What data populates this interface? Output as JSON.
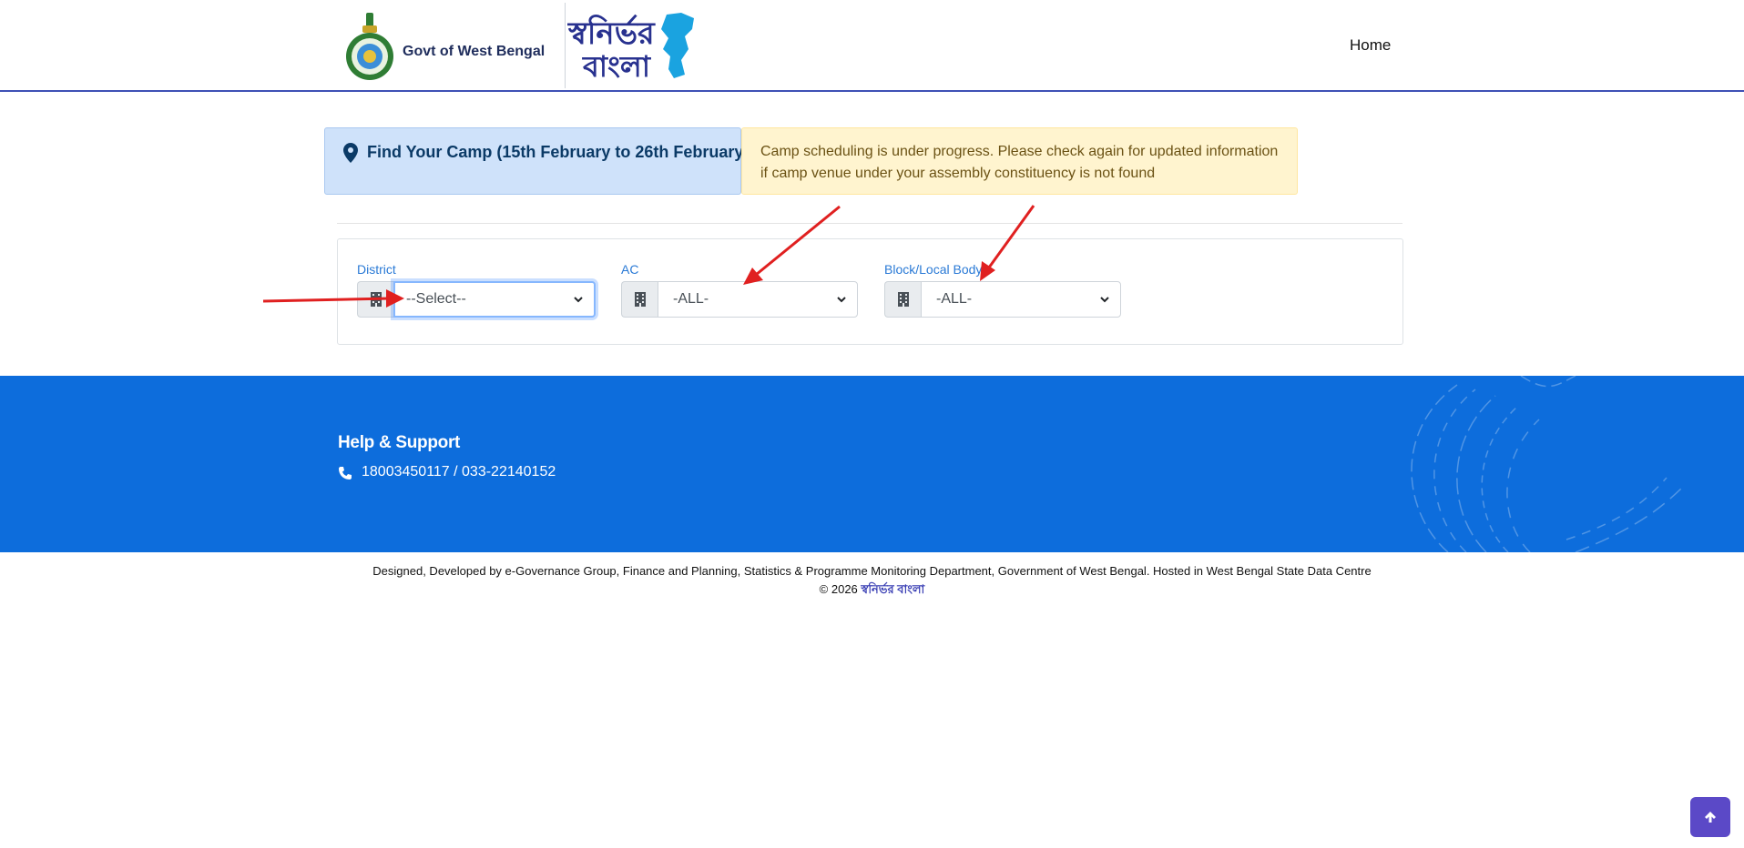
{
  "header": {
    "govt_name": "Govt of West Bengal",
    "brand_line1": "স্বনির্ভর",
    "brand_line2": "বাংলা",
    "nav_home": "Home"
  },
  "find_camp": {
    "title": "Find Your Camp (15th February to 26th February)",
    "notice": "Camp scheduling is under progress. Please check again for updated information if camp venue under your assembly constituency is not found"
  },
  "filters": {
    "district_label": "District",
    "district_value": "--Select--",
    "ac_label": "AC",
    "ac_value": "-ALL-",
    "block_label": "Block/Local Body",
    "block_value": "-ALL-"
  },
  "footer": {
    "help_title": "Help & Support",
    "phone": "18003450117 / 033-22140152"
  },
  "credits": {
    "line1": "Designed, Developed by e-Governance Group, Finance and Planning, Statistics & Programme Monitoring Department, Government of West Bengal. Hosted in West Bengal State Data Centre",
    "copyright": "© 2026",
    "brand": "স্বনির্ভর বাংলা"
  },
  "colors": {
    "accent": "#3f51b5",
    "footer_bg": "#0d6ddc",
    "info_bg": "#cfe2fa",
    "warning_bg": "#fff4cf",
    "arrow": "#e02020",
    "scroll_top_bg": "#5b49c7"
  },
  "icons": [
    "govt-emblem-icon",
    "brand-logo-icon",
    "map-pin-icon",
    "building-icon",
    "chevron-down-icon",
    "phone-icon",
    "arrow-up-icon"
  ]
}
